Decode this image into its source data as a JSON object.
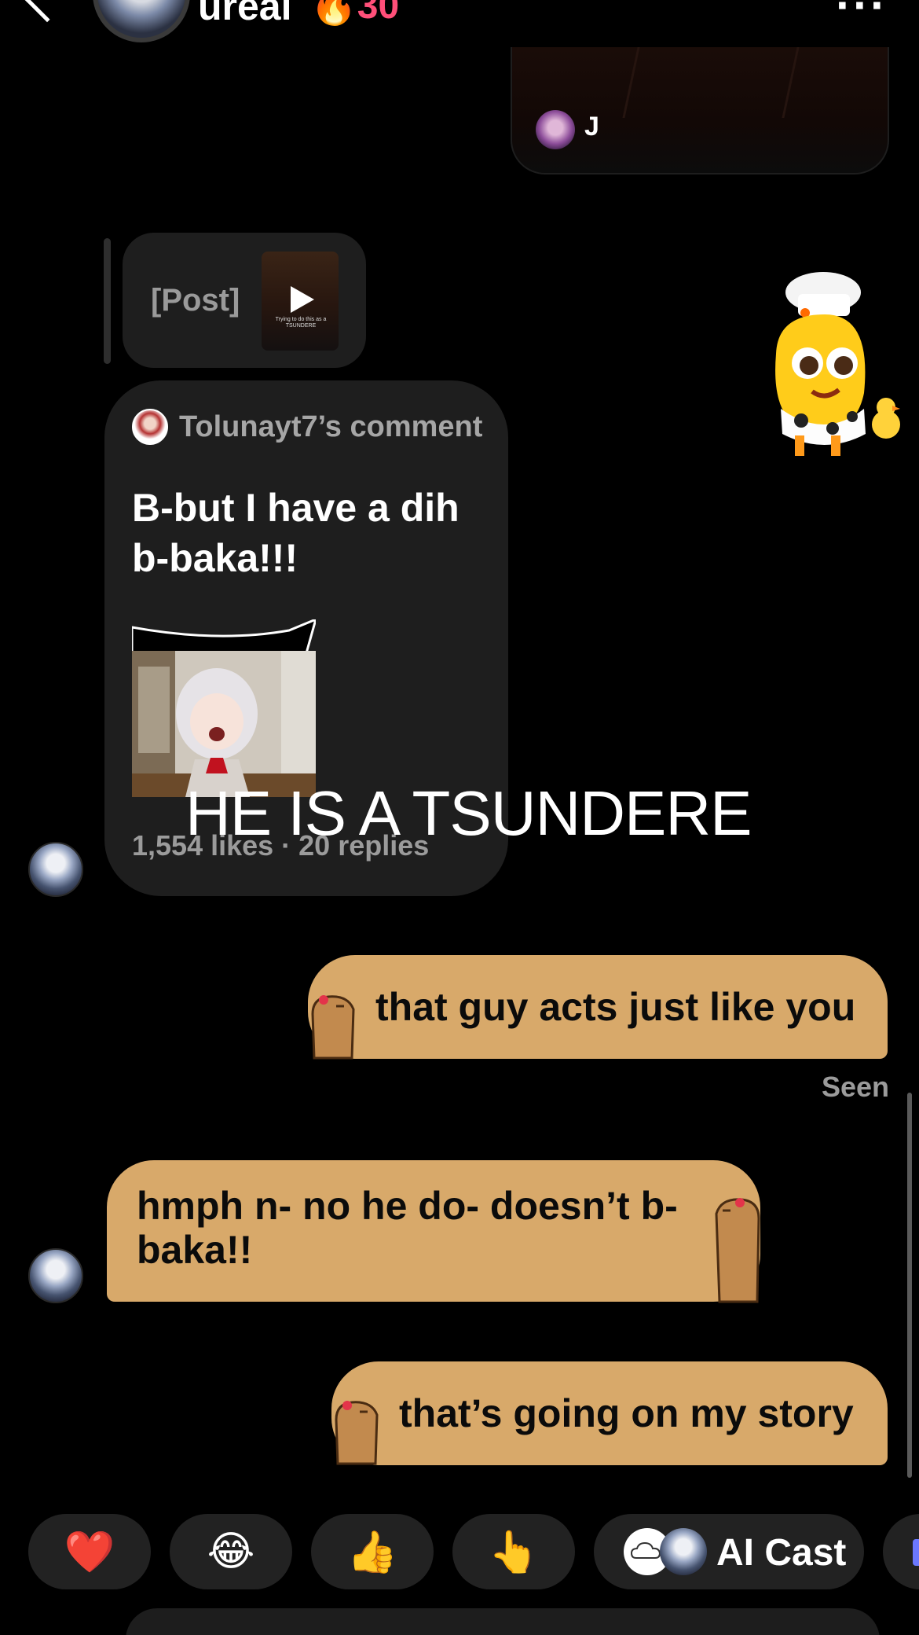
{
  "header": {
    "name": "ureal",
    "streak_count": "30",
    "streak_icon": "fire-icon"
  },
  "top_card": {
    "author_initial": "J"
  },
  "reply_quote": {
    "post_label": "[Post]",
    "thumb_caption": "Trying to do this as a TSUNDERE"
  },
  "comment_card": {
    "author": "Tolunayt7’s comment",
    "text": "B-but I have a dih b-baka!!!",
    "stats": "1,554 likes · 20 replies"
  },
  "overlay_caption": "HE IS A TSUNDERE",
  "messages": [
    {
      "direction": "sent",
      "text": "that guy acts just like you"
    },
    {
      "direction": "received",
      "text": "hmph n- no he do- doesn’t b-baka!!"
    },
    {
      "direction": "sent",
      "text": "that’s going on my story"
    }
  ],
  "seen_label": "Seen",
  "reactions": [
    {
      "emoji": "❤️",
      "icon": "heart-icon"
    },
    {
      "emoji": "😂",
      "icon": "laughing-emoji-icon"
    },
    {
      "emoji": "👍",
      "icon": "thumbs-up-icon"
    },
    {
      "emoji": "👆",
      "icon": "pointing-up-icon"
    }
  ],
  "ai_cast_label": "AI Cast",
  "colors": {
    "background": "#000000",
    "bubble": "#d8a96a",
    "card": "#1e1e1e",
    "streak": "#ff4f79"
  }
}
